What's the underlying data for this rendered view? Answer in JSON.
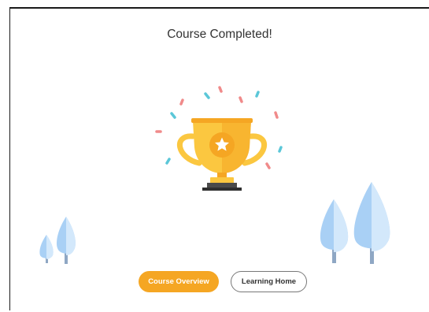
{
  "dialog": {
    "title": "Course Completed!"
  },
  "actions": {
    "course_overview_label": "Course Overview",
    "learning_home_label": "Learning Home"
  },
  "colors": {
    "accent": "#f5a623",
    "trophy_gold": "#fbc740",
    "trophy_dark_gold": "#f5a623",
    "trophy_base": "#4a4a4a",
    "confetti_pink": "#f08a8a",
    "confetti_teal": "#5bc7d8",
    "tree_light": "#d3e8fb",
    "tree_mid": "#a9d0f5",
    "tree_trunk": "#8fa7c4"
  },
  "illustration": {
    "main": "trophy-icon",
    "decor": [
      "confetti",
      "tree-icon"
    ]
  }
}
